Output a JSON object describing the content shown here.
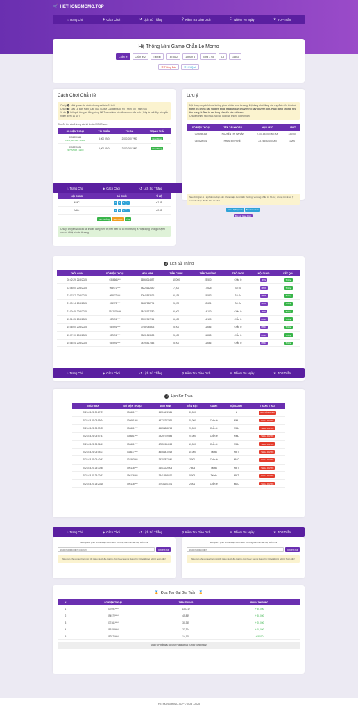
{
  "brand": "HETHONGMOMO.TOP",
  "nav": [
    {
      "label": "Trang Chủ",
      "icon": "home-icon",
      "glyph": "⌂"
    },
    {
      "label": "Cách Chơi",
      "icon": "gamepad-icon",
      "glyph": "◈"
    },
    {
      "label": "Lịch Sử Thắng",
      "icon": "history-icon",
      "glyph": "↺"
    },
    {
      "label": "Kiểm Tra Giao Dịch",
      "icon": "search-icon",
      "glyph": "⚲"
    },
    {
      "label": "Nhiệm Vụ Ngày",
      "icon": "tasks-icon",
      "glyph": "☷"
    },
    {
      "label": "TOP Tuần",
      "icon": "trophy-icon",
      "glyph": "♛"
    }
  ],
  "main": {
    "title": "Hệ Thống Mini Game Chẵn Lẻ Momo",
    "games": [
      "Chẵn lẻ",
      "Chẵn lẻ 2",
      "Tài xỉu",
      "Tài xỉu 2",
      "1 phần 3",
      "Tổng 3 số",
      "Lô",
      "Gấp 3"
    ],
    "extra_buttons": [
      "Thông Báo",
      "Kết Quả"
    ]
  },
  "howto": {
    "title": "Cách Chơi Chẵn lẻ",
    "notes": [
      "Chú ý 🅘: Mini game chỉ dành cho người trên 18 tuổi.",
      "Chú ý 🅘: Đây Là Bản Nâng Cấp Của CLMM Các Bạn Đọc Kỹ Trước Khi Tham Gia",
      "Vì dụ 🅘: Kết quả trùng số bằng công Mã Tham chiếu và mã random của web ( Đây là mất đẩy số ngẫu nhiên giêm 11 số )"
    ],
    "transfer_note": "Chuyển tiền vào 1 trong các tài khoản MOMO sau:",
    "headers": [
      "SỐ ĐIỆN THOẠI",
      "TỐI THIỂU",
      "TỐI ĐA",
      "TRẠNG THÁI"
    ],
    "rows": [
      {
        "phone": "0056950344",
        "sub": "2,378,841/50M - 1/200",
        "min": "5,000 VNĐ",
        "max": "2,000,000 VNĐ",
        "status": "Hoạt động"
      },
      {
        "phone": "0355295001",
        "sub": "23,755/50M - 1/200",
        "min": "5,000 VNĐ",
        "max": "2,000,000 VNĐ",
        "status": "Hoạt động"
      }
    ],
    "game_headers": [
      "NỘI DUNG",
      "SỐ CUỐI",
      "TỈ LỆ"
    ],
    "game_rows": [
      {
        "content": "MMC",
        "nums": [
          "2",
          "4",
          "6",
          "8"
        ],
        "rate": "x 2.35"
      },
      {
        "content": "MML",
        "nums": [
          "1",
          "3",
          "5",
          "7"
        ],
        "rate": "x 2.35"
      }
    ],
    "game_tags": [
      "Tiền thưởng",
      "Tiền cược",
      "Tỉ lệ"
    ],
    "bottom_note": "Chú ý: chuyển vào các tài khoản đang hiển thị trên web và có trình trạng là Hoạt động không chuyển vào số đã bị bảo trì thường."
  },
  "notice": {
    "title": "Lưu ý",
    "text1": "Nội dung chuyển khoản không phân biệt in hoa, thường. Nội dung phải đúng với quy định của trò chơi.",
    "text2": "Kiểm tra chính xác số điện thoại mà bạn cần chuyển rồi hãy chuyển tiền. Hoạt động không, nếu tìm trạng là Bảo trì vui lòng chuyển vào số khác.",
    "text3": "Chuyển thiếu hạn mức, sai nội dung sẽ không được hoàn.",
    "headers": [
      "SỐ ĐIỆN THOẠI",
      "TÊN TÀI KHOẢN",
      "HẠN MỨC",
      "LƯỢT"
    ],
    "rows": [
      {
        "phone": "0056950344",
        "name": "NGUYỄN THI HA VÂN",
        "limit": "2,378,841/50,000,000",
        "turns": "132/200"
      },
      {
        "phone": "0355295001",
        "name": "PHẠM MINH VIỆT",
        "limit": "23,755/50,000,000",
        "turns": "1/200"
      }
    ],
    "bottom": "Sau thời gian 1 - 2 phút nếu bạn vẫn chưa nhận được tiền thưởng, vui lòng nhắn tin hỗ trợ, chúng tôi sẽ xử lý sớm cho bạn. Nhấn bên tôi nhé!",
    "btn1": "Liên Hệ Support",
    "btn2": "Box Giao Lưu",
    "btn3": "Bot Hỗ Giao Dịch"
  },
  "wins": {
    "title": "Lịch Sử Thắng",
    "headers": [
      "THỜI GIAN",
      "SỐ ĐIỆN THOẠI",
      "MGD NEW",
      "TIỀN CƯỢC",
      "TIỀN THƯỞNG",
      "TRÒ CHƠI",
      "NỘI DUNG",
      "KẾT QUẢ"
    ],
    "rows": [
      [
        "08:42:29, 21/3/2025",
        "0366661***",
        "16568014897",
        "10,000",
        "23,500",
        "Chẵn lẻ",
        "MML",
        "Thắng"
      ],
      [
        "22:08:00, 20/3/2025",
        "094972****",
        "58223162440",
        "7,500",
        "17,625",
        "Tài xỉu",
        "MMX",
        "Thắng"
      ],
      [
        "22:07:57, 20/3/2025",
        "094972****",
        "50942553036",
        "6,635",
        "15,593",
        "Tài xỉu",
        "MMX",
        "Thắng"
      ],
      [
        "21:09:14, 20/3/2025",
        "094972****",
        "51887882771",
        "5,370",
        "12,651",
        "Tài xỉu",
        "MMX",
        "Thắng"
      ],
      [
        "21:00:45, 20/3/2025",
        "0912079****",
        "18432127780",
        "6,000",
        "14,100",
        "Chẵn lẻ",
        "MML",
        "Thắng"
      ],
      [
        "15:51:05, 20/3/2025",
        "037691****",
        "50502047261",
        "6,000",
        "14,100",
        "Chẵn lẻ",
        "MMC",
        "Thắng"
      ],
      [
        "15:06:00, 20/3/2025",
        "037691****",
        "37982085303",
        "5,000",
        "11,666",
        "Chẵn lẻ",
        "MMC",
        "Thắng"
      ],
      [
        "15:07:10, 20/3/2025",
        "037691****",
        "38631513653",
        "5,000",
        "11,868",
        "Chẵn lẻ",
        "MMC",
        "Thắng"
      ],
      [
        "15:06:44, 20/3/2025",
        "037691****",
        "38196517463",
        "5,000",
        "11,666",
        "Chẵn lẻ",
        "MMC",
        "Thắng"
      ]
    ]
  },
  "losses": {
    "title": "Lịch Sử Thua",
    "headers": [
      "THỜI GIAN",
      "SỐ ĐIỆN THOẠI",
      "MGD NEW",
      "TIỀN ĐẶT",
      "GAME",
      "NỘI DUNG",
      "TRẠNG THÁI"
    ],
    "rows": [
      [
        "2025-03-21 09:27:27",
        "036661****",
        "15513472461",
        "30,000",
        "",
        "L",
        "SAI NỘI DUNG"
      ],
      [
        "2025-03-21 08:59:24",
        "036661****",
        "43722797396",
        "20,000",
        "Chẵn lẻ",
        "MML",
        "THUA CƯỢC"
      ],
      [
        "2025-03-21 08:59:25",
        "036661****",
        "64833868748",
        "20,000",
        "Chẵn lẻ",
        "MML",
        "THUA CƯỢC"
      ],
      [
        "2025-03-21 08:57:57",
        "036661****",
        "39292759983",
        "20,000",
        "Chẵn lẻ",
        "MML",
        "THUA CƯỢC"
      ],
      [
        "2025-03-21 08:56:41",
        "036661****",
        "67851584918",
        "10,000",
        "Chẵn lẻ",
        "MML",
        "THUA CƯỢC"
      ],
      [
        "2025-03-21 05:04:07",
        "038617****",
        "44054870919",
        "10,000",
        "Tài xỉu",
        "MMT",
        "THUA CƯỢC"
      ],
      [
        "2025-03-21 05:40:43",
        "034563****",
        "39307832041",
        "3,001",
        "Chẵn lẻ",
        "MMC",
        "THUA CƯỢC"
      ],
      [
        "2025-03-20 23:30:40",
        "096136****",
        "36514229003",
        "7,603",
        "Tài xỉu",
        "MMT",
        "THUA CƯỢC"
      ],
      [
        "2025-03-20 23:30:57",
        "096136****",
        "38413569410",
        "5,004",
        "Tài xỉu",
        "MMT",
        "THUA CƯỢC"
      ],
      [
        "2025-03-20 23:23:16",
        "096136****",
        "37933251371",
        "2,001",
        "Chẵn lẻ",
        "MMC",
        "THUA CƯỢC"
      ]
    ]
  },
  "check1": {
    "hint": "Nếu quá 5 phút chưa nhận được tiền vui lòng dán mã vào đây kiểm tra",
    "placeholder": "Nhập mã giao dịch của bạn",
    "btn": "Kiểm tra",
    "note": "Nếu bạn chuyển sai hạn mức tối thiểu và tối đa của trò chơi hoặc sai nội dung, hệ thống không hỗ trợ hoàn tiền!"
  },
  "check2": {
    "hint": "Nếu quá 5 phút chưa nhận được tiền vui lòng dán mã vào đây kiểm tra",
    "placeholder": "Nhập mã giao dịch",
    "btn": "Kiểm tra",
    "note": "Nếu bạn chuyển sai hạn mức tối thiểu và tối đa của trò chơi hoặc sai nội dung, hệ thống không hỗ trợ hoàn tiền!"
  },
  "top": {
    "title": "Đua Top Đại Gia Tuần",
    "headers": [
      "#",
      "SỐ ĐIỆN THOẠI",
      "TIỀN THẮNG",
      "PHẦN THƯỞNG"
    ],
    "rows": [
      [
        "1",
        "037691****",
        "133,212",
        "+ 50,000"
      ],
      [
        "2",
        "094972****",
        "45,839",
        "+ 30,000"
      ],
      [
        "3",
        "077461****",
        "30,355",
        "+ 20,000"
      ],
      [
        "4",
        "096158****",
        "23,304",
        "+ 10,000"
      ],
      [
        "5",
        "052876****",
        "14,100",
        "+ 5,000"
      ]
    ],
    "note": "Đua TOP bắt đầu từ 0h00 và chốt lúc 23h59 cùng ngày."
  },
  "footer": "HETHONGMOMO.TOP © 2023 - 2025",
  "colors": {
    "primary": "#6a2fb0",
    "success": "#39b54a",
    "danger": "#e43b2c"
  }
}
